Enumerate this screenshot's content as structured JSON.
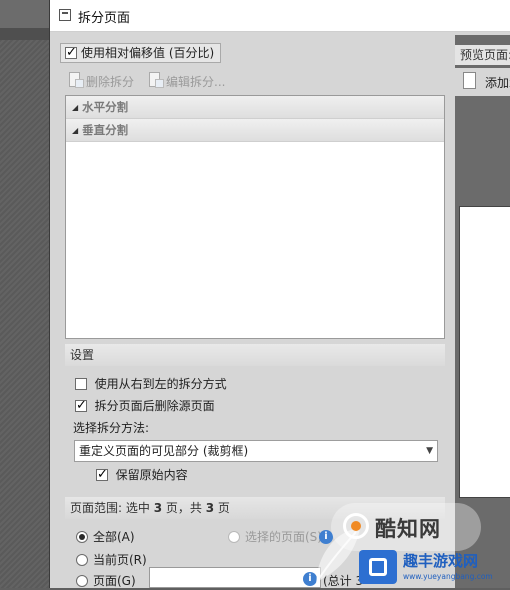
{
  "window": {
    "title": "拆分页面"
  },
  "relative_offset": {
    "label": "使用相对偏移值 (百分比)",
    "checked": true
  },
  "toolbar": {
    "delete_split": {
      "label": "删除拆分",
      "icon": "delete-split-icon"
    },
    "edit_split": {
      "label": "编辑拆分...",
      "icon": "edit-split-icon"
    }
  },
  "split_groups": [
    {
      "label": "水平分割"
    },
    {
      "label": "垂直分割"
    }
  ],
  "settings": {
    "header": "设置",
    "rtl_split": {
      "label": "使用从右到左的拆分方式",
      "checked": false
    },
    "delete_source": {
      "label": "拆分页面后删除源页面",
      "checked": true
    },
    "method_label": "选择拆分方法:",
    "method_value": "重定义页面的可见部分 (裁剪框)",
    "keep_original": {
      "label": "保留原始内容",
      "checked": true
    }
  },
  "page_range": {
    "header_prefix": "页面范围: 选中",
    "selected_count": "3",
    "header_mid": "页，共",
    "total_count": "3",
    "header_suffix": "页",
    "all": {
      "label": "全部(A)",
      "selected": true
    },
    "selection": {
      "label": "选择的页面(S)",
      "selected": false
    },
    "current": {
      "label": "当前页(R)",
      "selected": false
    },
    "pages": {
      "label": "页面(G)",
      "selected": false,
      "value": ""
    },
    "total_note": "(总计 3"
  },
  "preview": {
    "label": "预览页面:",
    "add_label": "添加水"
  },
  "watermarks": {
    "brand1": "酷知网",
    "brand2": "趣丰游戏网",
    "brand2_url": "www.yueyangbang.com"
  },
  "colors": {
    "dialog_bg": "#d6d6d6",
    "list_bg": "#ffffff",
    "info_icon": "#3f7fd0"
  }
}
